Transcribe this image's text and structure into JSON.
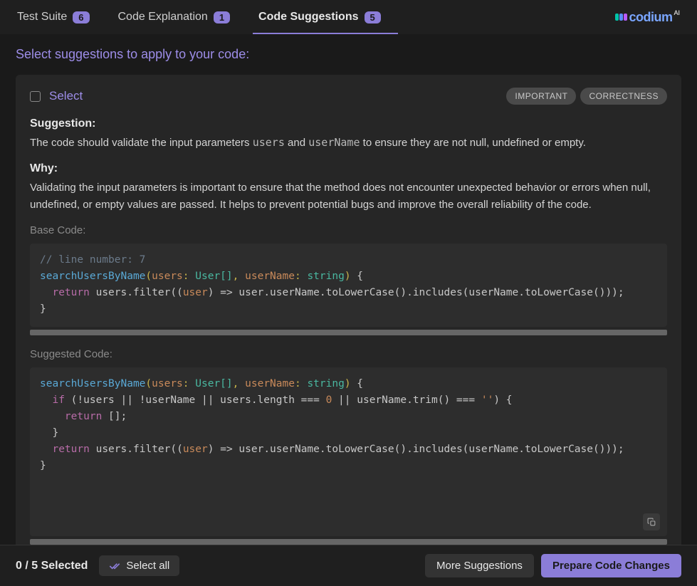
{
  "tabs": [
    {
      "label": "Test Suite",
      "count": "6",
      "active": false
    },
    {
      "label": "Code Explanation",
      "count": "1",
      "active": false
    },
    {
      "label": "Code Suggestions",
      "count": "5",
      "active": true
    }
  ],
  "brand": {
    "name": "codium",
    "suffix": "AI"
  },
  "prompt": "Select suggestions to apply to your code:",
  "suggestion": {
    "select_label": "Select",
    "tags": [
      "IMPORTANT",
      "CORRECTNESS"
    ],
    "suggestion_label": "Suggestion:",
    "suggestion_text_pre": "The code should validate the input parameters ",
    "suggestion_code1": "users",
    "suggestion_mid": " and ",
    "suggestion_code2": "userName",
    "suggestion_text_post": " to ensure they are not null, undefined or empty.",
    "why_label": "Why:",
    "why_text": "Validating the input parameters is important to ensure that the method does not encounter unexpected behavior or errors when null, undefined, or empty values are passed. It helps to prevent potential bugs and improve the overall reliability of the code.",
    "base_label": "Base Code:",
    "base_code": {
      "comment": "// line number: 7",
      "fn": "searchUsersByName",
      "sig_users": "users",
      "sig_usertype": "User[]",
      "sig_uname": "userName",
      "sig_str": "string",
      "ret": "return",
      "body_users": "users",
      "body_filter": ".filter((",
      "body_user": "user",
      "body_arrow": ") => user.userName.toLowerCase().includes(userName.toLowerCase()));"
    },
    "suggested_label": "Suggested Code:",
    "suggested_code": {
      "fn": "searchUsersByName",
      "if_kw": "if",
      "if_cond": " (!users || !userName || users.length === ",
      "zero": "0",
      "if_cond2": " || userName.trim() === ",
      "empty": "''",
      "if_close": ") {",
      "ret_empty_kw": "return",
      "ret_empty": " [];",
      "ret": "return",
      "body_users": "users",
      "body_filter": ".filter((",
      "body_user": "user",
      "body_arrow": ") => user.userName.toLowerCase().includes(userName.toLowerCase()));"
    }
  },
  "footer": {
    "selected": "0 / 5 Selected",
    "select_all": "Select all",
    "more": "More Suggestions",
    "prepare": "Prepare Code Changes"
  }
}
